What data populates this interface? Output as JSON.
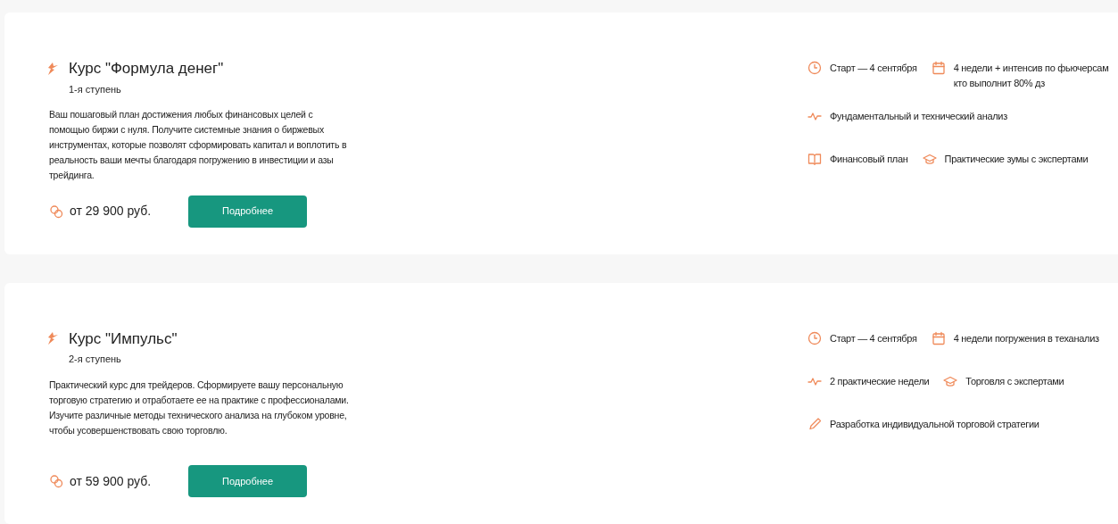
{
  "courses": [
    {
      "title": "Курс \"Формула денег\"",
      "step": "1-я ступень",
      "description": "Ваш пошаговый план достижения любых финансовых целей с помощью биржи с нуля. Получите системные знания о биржевых инструментах, которые позволят сформировать капитал и воплотить в реальность ваши мечты благодаря погружению в инвестиции и азы трейдинга.",
      "price": "от 29 900 руб.",
      "button": "Подробнее",
      "feature_rows": [
        [
          {
            "kind": "clock",
            "lines": [
              "Старт — 4 сентября"
            ]
          },
          {
            "kind": "calendar",
            "lines": [
              "4 недели + интенсив по фьючерсам",
              "кто выполнит 80% дз"
            ]
          }
        ],
        [
          {
            "kind": "pulse",
            "lines": [
              "Фундаментальный и технический анализ"
            ]
          }
        ],
        [
          {
            "kind": "book",
            "lines": [
              "Финансовый план"
            ]
          },
          {
            "kind": "cap",
            "lines": [
              "Практические зумы с экспертами"
            ]
          }
        ]
      ]
    },
    {
      "title": "Курс \"Импульс\"",
      "step": "2-я ступень",
      "description": "Практический курс для трейдеров. Сформируете вашу персональную торговую стратегию и отработаете ее на практике с профессионалами. Изучите различные методы технического анализа на глубоком уровне, чтобы усовершенствовать свою торговлю.",
      "price": "от 59 900 руб.",
      "button": "Подробнее",
      "feature_rows": [
        [
          {
            "kind": "clock",
            "lines": [
              "Старт — 4 сентября"
            ]
          },
          {
            "kind": "calendar",
            "lines": [
              "4 недели погружения в теханализ"
            ]
          }
        ],
        [
          {
            "kind": "pulse",
            "lines": [
              "2 практические недели"
            ]
          },
          {
            "kind": "cap",
            "lines": [
              "Торговля с экспертами"
            ]
          }
        ],
        [
          {
            "kind": "pencil",
            "lines": [
              "Разработка индивидуальной торговой стратегии"
            ]
          }
        ]
      ]
    }
  ]
}
